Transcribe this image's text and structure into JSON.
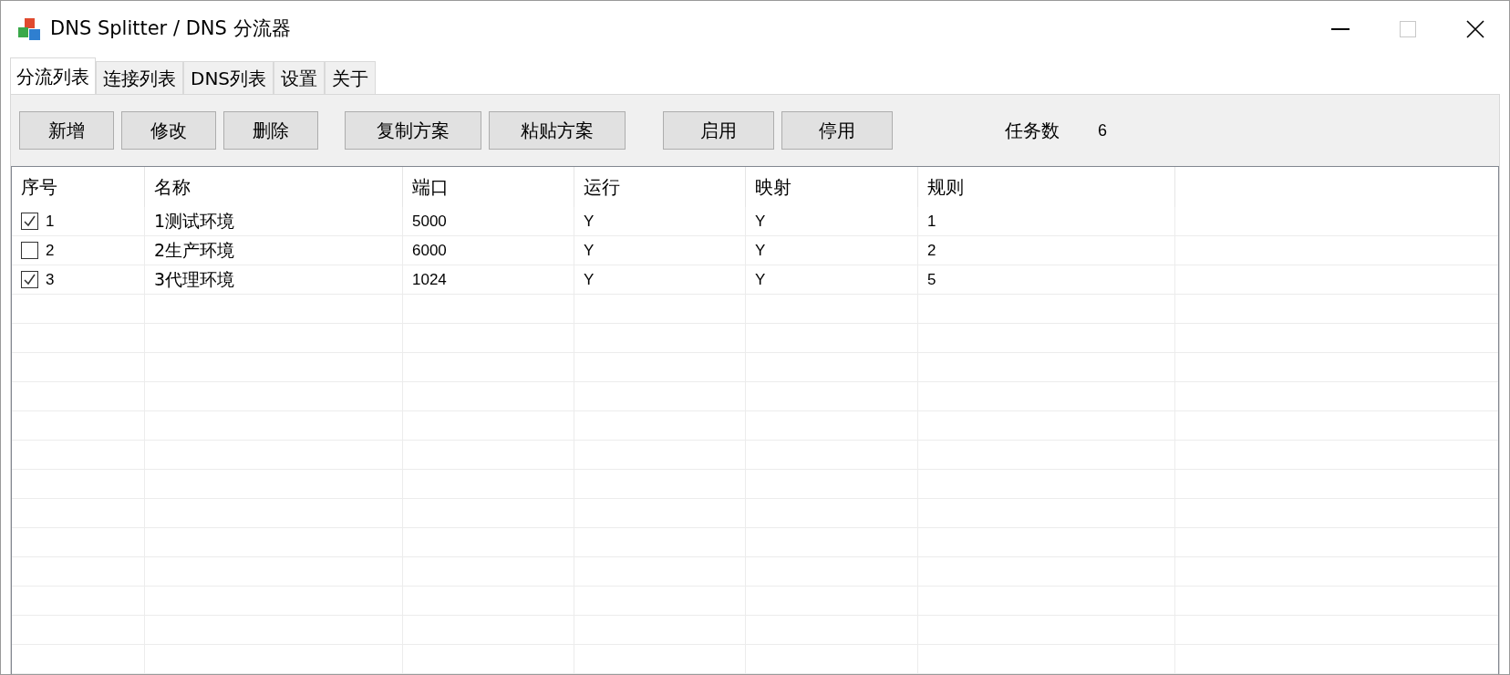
{
  "window": {
    "title": "DNS Splitter / DNS 分流器"
  },
  "tabs": [
    {
      "label": "分流列表",
      "selected": true
    },
    {
      "label": "连接列表",
      "selected": false
    },
    {
      "label": "DNS列表",
      "selected": false
    },
    {
      "label": "设置",
      "selected": false
    },
    {
      "label": "关于",
      "selected": false
    }
  ],
  "toolbar": {
    "groups": [
      [
        "新增",
        "修改",
        "删除"
      ],
      [
        "复制方案",
        "粘贴方案"
      ],
      [
        "启用",
        "停用"
      ]
    ],
    "task_count_label": "任务数",
    "task_count": "6"
  },
  "table": {
    "columns": [
      "序号",
      "名称",
      "端口",
      "运行",
      "映射",
      "规则"
    ],
    "rows": [
      {
        "checked": true,
        "cells": [
          "1",
          "1测试环境",
          "5000",
          "Y",
          "Y",
          "1"
        ]
      },
      {
        "checked": false,
        "cells": [
          "2",
          "2生产环境",
          "6000",
          "Y",
          "Y",
          "2"
        ]
      },
      {
        "checked": true,
        "cells": [
          "3",
          "3代理环境",
          "1024",
          "Y",
          "Y",
          "5"
        ]
      }
    ]
  }
}
